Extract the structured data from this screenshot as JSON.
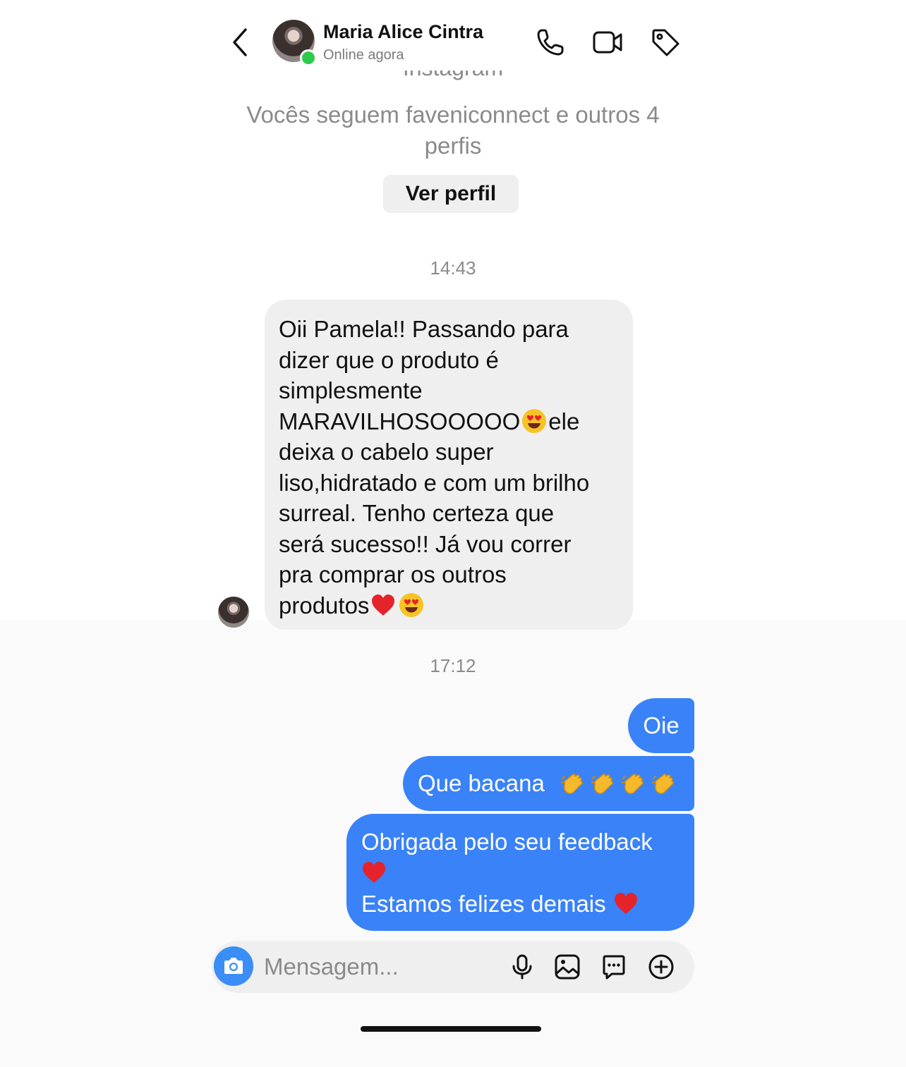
{
  "header": {
    "contact_name": "Maria Alice Cintra",
    "status": "Online agora",
    "icons": [
      "back-icon",
      "phone-icon",
      "video-icon",
      "tag-icon"
    ]
  },
  "profile": {
    "partial_text": "Instagram",
    "mutual_line1": "Vocês seguem faveniconnect e outros 4",
    "mutual_line2": "perfis",
    "view_profile_label": "Ver perfil"
  },
  "messages": {
    "time_1": "14:43",
    "incoming": {
      "lines": [
        "Oii Pamela!! Passando para",
        "dizer que o produto é",
        "simplesmente",
        "MARAVILHOSOOOOO",
        "ele",
        "deixa o cabelo super",
        "liso,hidratado e com um brilho",
        "surreal. Tenho certeza que",
        "será sucesso!! Já vou correr",
        "pra comprar os outros",
        "produtos"
      ],
      "emojis": [
        "heart-eyes-emoji",
        "red-heart-emoji"
      ]
    },
    "time_2": "17:12",
    "outgoing": [
      {
        "text": "Oie"
      },
      {
        "text": "Que bacana",
        "emojis": [
          "clapping-hands-emoji"
        ]
      },
      {
        "line1": "Obrigada pelo seu feedback",
        "line2": "Estamos felizes demais",
        "emojis": [
          "red-heart-emoji"
        ]
      }
    ]
  },
  "composer": {
    "placeholder": "Mensagem...",
    "icons": [
      "camera-icon",
      "microphone-icon",
      "gallery-icon",
      "sticker-icon",
      "add-icon"
    ]
  },
  "colors": {
    "outgoing_bubble": "#3a82f7",
    "incoming_bubble": "#efefef",
    "online_dot": "#2ecb4b",
    "secondary_text": "#8a8a8a"
  }
}
